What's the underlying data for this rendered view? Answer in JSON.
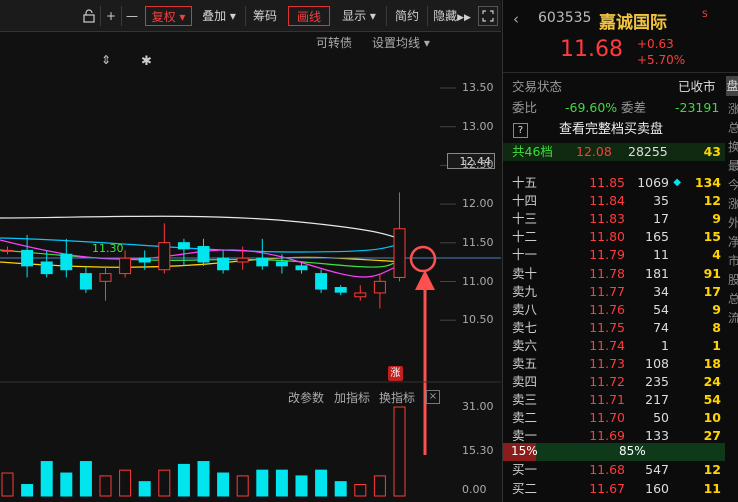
{
  "toolbar": {
    "lock_icon": "lock-icon",
    "plus": "+",
    "minus": "—",
    "fuquan": "复权",
    "diejia": "叠加",
    "chouma": "筹码",
    "huaxian": "画线",
    "xianshi": "显示",
    "jianyue": "简约",
    "yincang": "隐藏",
    "fullscreen_icon": "fullscreen-icon"
  },
  "chart": {
    "convertible": "可转债",
    "set_ma": "设置均线",
    "ma_label": "11.30",
    "price_tag": "12.44",
    "limit_up_badge": "涨",
    "y_labels": [
      "13.50",
      "13.00",
      "12.50",
      "12.00",
      "11.50",
      "11.00",
      "10.50"
    ],
    "volume_y_labels": [
      "31.00",
      "15.30",
      "0.00"
    ],
    "indicator_links": [
      "改参数",
      "加指标",
      "换指标"
    ],
    "close_icon": "close-icon",
    "annotation_color": "#ff5050"
  },
  "chart_data": {
    "type": "candlestick",
    "ylim": [
      10.3,
      13.7
    ],
    "candles": [
      {
        "o": 11.4,
        "c": 11.4,
        "h": 11.45,
        "l": 11.35
      },
      {
        "o": 11.4,
        "c": 11.2,
        "h": 11.6,
        "l": 11.05
      },
      {
        "o": 11.25,
        "c": 11.1,
        "h": 11.4,
        "l": 11.05
      },
      {
        "o": 11.35,
        "c": 11.15,
        "h": 11.55,
        "l": 11.05
      },
      {
        "o": 11.1,
        "c": 10.9,
        "h": 11.2,
        "l": 10.85
      },
      {
        "o": 11.0,
        "c": 11.1,
        "h": 11.2,
        "l": 10.75
      },
      {
        "o": 11.1,
        "c": 11.3,
        "h": 11.4,
        "l": 11.05
      },
      {
        "o": 11.3,
        "c": 11.25,
        "h": 11.4,
        "l": 11.15
      },
      {
        "o": 11.15,
        "c": 11.5,
        "h": 11.75,
        "l": 11.1
      },
      {
        "o": 11.5,
        "c": 11.42,
        "h": 11.55,
        "l": 11.2
      },
      {
        "o": 11.45,
        "c": 11.25,
        "h": 11.55,
        "l": 11.2
      },
      {
        "o": 11.3,
        "c": 11.15,
        "h": 11.4,
        "l": 11.1
      },
      {
        "o": 11.25,
        "c": 11.3,
        "h": 11.45,
        "l": 11.15
      },
      {
        "o": 11.3,
        "c": 11.2,
        "h": 11.55,
        "l": 11.15
      },
      {
        "o": 11.25,
        "c": 11.2,
        "h": 11.35,
        "l": 11.1
      },
      {
        "o": 11.2,
        "c": 11.15,
        "h": 11.25,
        "l": 11.1
      },
      {
        "o": 11.1,
        "c": 10.9,
        "h": 11.15,
        "l": 10.85
      },
      {
        "o": 10.92,
        "c": 10.86,
        "h": 10.95,
        "l": 10.82
      },
      {
        "o": 10.8,
        "c": 10.85,
        "h": 10.95,
        "l": 10.75
      },
      {
        "o": 10.85,
        "c": 11.0,
        "h": 11.1,
        "l": 10.65
      },
      {
        "o": 11.05,
        "c": 11.68,
        "h": 12.15,
        "l": 11.0
      }
    ],
    "volumes": [
      8,
      4,
      12,
      8,
      12,
      7,
      9,
      5,
      9,
      11,
      12,
      8,
      7,
      9,
      9,
      7,
      9,
      5,
      4,
      7,
      31
    ]
  },
  "stock": {
    "code": "603535",
    "name": "嘉诚国际",
    "flag": "S",
    "price": "11.68",
    "change": "+0.63",
    "change_pct": "+5.70%"
  },
  "status": {
    "label": "交易状态",
    "value": "已收市",
    "side_tab": "盘"
  },
  "weibi": {
    "label": "委比",
    "value": "-69.60%",
    "diff_label": "委差",
    "diff_value": "-23191"
  },
  "full_book": {
    "icon": "?",
    "label": "查看完整档买卖盘"
  },
  "total": {
    "label": "共46档",
    "price": "12.08",
    "volume": "28255",
    "count": "43"
  },
  "asks": [
    {
      "label": "十五",
      "price": "11.85",
      "vol": "1069",
      "chg": "134",
      "marker": "◆"
    },
    {
      "label": "十四",
      "price": "11.84",
      "vol": "35",
      "chg": "12",
      "marker": ""
    },
    {
      "label": "十三",
      "price": "11.83",
      "vol": "17",
      "chg": "9",
      "marker": ""
    },
    {
      "label": "十二",
      "price": "11.80",
      "vol": "165",
      "chg": "15",
      "marker": ""
    },
    {
      "label": "十一",
      "price": "11.79",
      "vol": "11",
      "chg": "4",
      "marker": ""
    },
    {
      "label": "卖十",
      "price": "11.78",
      "vol": "181",
      "chg": "91",
      "marker": ""
    },
    {
      "label": "卖九",
      "price": "11.77",
      "vol": "34",
      "chg": "17",
      "marker": ""
    },
    {
      "label": "卖八",
      "price": "11.76",
      "vol": "54",
      "chg": "9",
      "marker": ""
    },
    {
      "label": "卖七",
      "price": "11.75",
      "vol": "74",
      "chg": "8",
      "marker": ""
    },
    {
      "label": "卖六",
      "price": "11.74",
      "vol": "1",
      "chg": "1",
      "marker": ""
    },
    {
      "label": "卖五",
      "price": "11.73",
      "vol": "108",
      "chg": "18",
      "marker": ""
    },
    {
      "label": "卖四",
      "price": "11.72",
      "vol": "235",
      "chg": "24",
      "marker": ""
    },
    {
      "label": "卖三",
      "price": "11.71",
      "vol": "217",
      "chg": "54",
      "marker": ""
    },
    {
      "label": "卖二",
      "price": "11.70",
      "vol": "50",
      "chg": "10",
      "marker": ""
    },
    {
      "label": "卖一",
      "price": "11.69",
      "vol": "133",
      "chg": "27",
      "marker": ""
    }
  ],
  "ratio": {
    "sell_pct": "15%",
    "buy_pct": "85%",
    "sell_fraction": 0.15
  },
  "bids": [
    {
      "label": "买一",
      "price": "11.68",
      "vol": "547",
      "chg": "12"
    },
    {
      "label": "买二",
      "price": "11.67",
      "vol": "160",
      "chg": "11"
    }
  ],
  "edge_chars": [
    "涨",
    "总",
    "换",
    "最",
    "今",
    "涨",
    "外",
    "净",
    "市",
    "股",
    "总",
    "流"
  ]
}
